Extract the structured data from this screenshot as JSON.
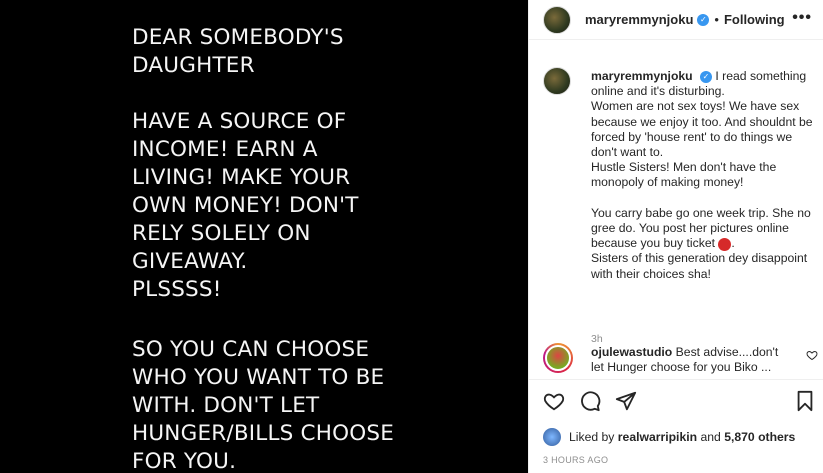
{
  "image_text": {
    "block1": "DEAR SOMEBODY'S\nDAUGHTER",
    "block2": "HAVE A SOURCE OF\nINCOME! EARN A\nLIVING! MAKE YOUR\nOWN MONEY! DON'T\nRELY SOLELY ON\nGIVEAWAY.\nPLSSSS!",
    "block3": "SO YOU CAN CHOOSE\nWHO YOU WANT  TO BE\nWITH. DON'T LET\nHUNGER/BILLS CHOOSE\nFOR YOU."
  },
  "header": {
    "username": "maryremmynjoku",
    "separator": "•",
    "follow_label": "Following",
    "more_label": "•••"
  },
  "caption": {
    "username": "maryremmynjoku",
    "text_part1": "I read something online and it's disturbing.\nWomen are not sex toys! We have sex because we enjoy it too. And shouldnt be forced by 'house rent' to do things we don't want to.\nHustle Sisters! Men don't have the monopoly of making money!\n\nYou carry babe go one week trip. She no gree do. You post her pictures online because you buy ticket ",
    "emoji": "angry-face-icon",
    "text_part2": ".\nSisters of this generation dey disappoint with their choices sha!",
    "time": "3h"
  },
  "comment": {
    "username": "ojulewastudio",
    "text": "Best advise....don't let Hunger choose for you Biko ..."
  },
  "likes": {
    "prefix": "Liked by ",
    "user": "realwarripikin",
    "middle": " and ",
    "others": "5,870 others"
  },
  "posted_time": "3 HOURS AGO",
  "colors": {
    "image_bg": "#000000",
    "verified": "#3897f0",
    "muted": "#8e8e8e"
  }
}
